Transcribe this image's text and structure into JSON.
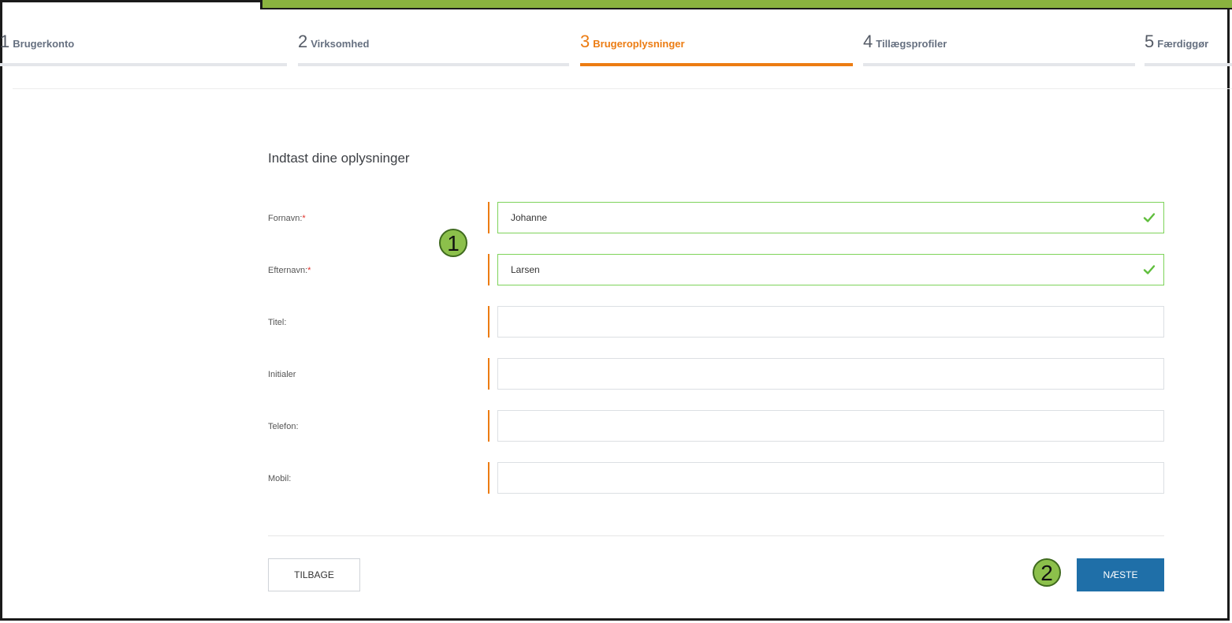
{
  "steps": [
    {
      "num": "1",
      "label": "Brugerkonto"
    },
    {
      "num": "2",
      "label": "Virksomhed"
    },
    {
      "num": "3",
      "label": "Brugeroplysninger"
    },
    {
      "num": "4",
      "label": "Tillægsprofiler"
    },
    {
      "num": "5",
      "label": "Færdiggør"
    }
  ],
  "active_step": 3,
  "form": {
    "title": "Indtast dine oplysninger",
    "fields": [
      {
        "label": "Fornavn:",
        "required": "*",
        "value": "Johanne"
      },
      {
        "label": "Efternavn:",
        "required": "*",
        "value": "Larsen"
      },
      {
        "label": "Titel:",
        "value": ""
      },
      {
        "label": "Initialer",
        "value": ""
      },
      {
        "label": "Telefon:",
        "value": ""
      },
      {
        "label": "Mobil:",
        "value": ""
      }
    ]
  },
  "buttons": {
    "back": "TILBAGE",
    "next": "NÆSTE"
  },
  "annotations": {
    "first": "1",
    "second": "2"
  },
  "colors": {
    "accent": "#ec7c12",
    "primary": "#1f6fa8",
    "valid": "#7ed35a",
    "banner": "#8ab33f"
  }
}
